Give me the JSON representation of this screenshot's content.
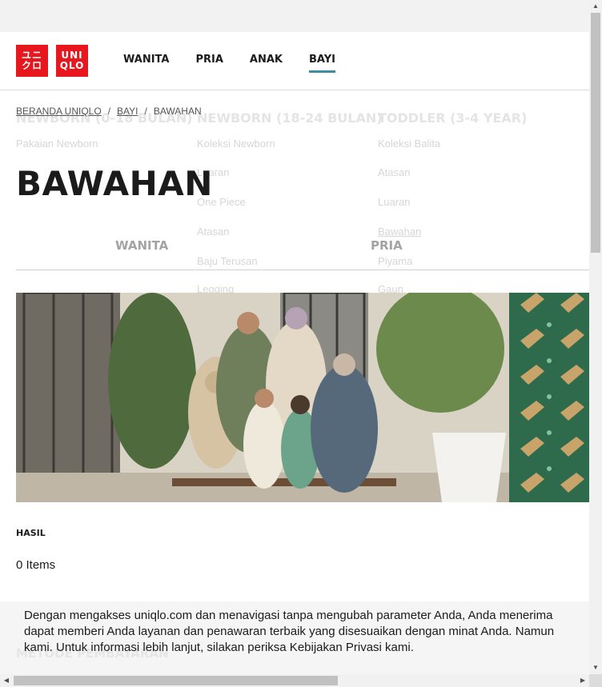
{
  "logo": {
    "line1": "ユニ",
    "line2": "クロ",
    "line3": "UNI",
    "line4": "QLO"
  },
  "nav": [
    "WANITA",
    "PRIA",
    "ANAK",
    "BAYI"
  ],
  "active_nav": "BAYI",
  "menu_ghost": {
    "col1": {
      "heading": "NEWBORN (0-18 BULAN)",
      "items": [
        "Pakaian Newborn"
      ]
    },
    "col2": {
      "heading": "NEWBORN (18-24 BULAN)",
      "items": [
        "Koleksi Newborn",
        "Luaran",
        "One Piece",
        "Atasan",
        "Baju Terusan",
        "Legging"
      ]
    },
    "col3": {
      "heading": "TODDLER (3-4 YEAR)",
      "items": [
        "Koleksi Balita",
        "Atasan",
        "Luaran",
        "Bawahan",
        "Piyama",
        "Gaun"
      ]
    }
  },
  "breadcrumb": [
    "BERANDA UNIQLO",
    "BAYI",
    "BAWAHAN"
  ],
  "breadcrumb_sep": "/",
  "page_title": "BAWAHAN",
  "gender_tabs": [
    "WANITA",
    "PRIA"
  ],
  "results": {
    "label": "HASIL",
    "count": "0 Items"
  },
  "cookie": {
    "line1": "Dengan mengakses uniqlo.com dan menavigasi tanpa mengubah parameter Anda, Anda menerima",
    "line2": "dapat memberi Anda layanan dan penawaran terbaik yang disesuaikan dengan minat Anda. Namun",
    "line3": "kami. Untuk informasi lebih lanjut, silakan periksa Kebijakan Privasi kami.",
    "ghost": "METODE PEMBAYARAN"
  },
  "colors": {
    "brand_red": "#e8171e",
    "active_underline": "#3a8ea0",
    "hero_green": "#2e6b4c"
  }
}
